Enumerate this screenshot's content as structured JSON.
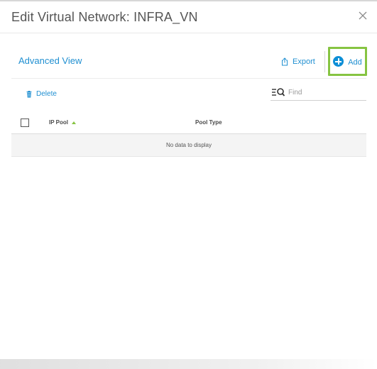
{
  "dialog": {
    "title": "Edit Virtual Network: INFRA_VN"
  },
  "panel": {
    "view_title": "Advanced View",
    "export_label": "Export",
    "add_label": "Add",
    "add_highlight_color": "#86c442",
    "accent_color": "#1f8fd1"
  },
  "toolbar": {
    "delete_label": "Delete",
    "find_placeholder": "Find",
    "find_value": ""
  },
  "table": {
    "columns": [
      {
        "label": "IP Pool",
        "sorted": "ascending"
      },
      {
        "label": "Pool Type"
      }
    ],
    "rows": [],
    "empty_message": "No data to display"
  },
  "icons": {
    "close": "close-icon",
    "export": "export-icon",
    "add": "plus-circle-icon",
    "delete": "trash-icon",
    "find": "filter-search-icon"
  }
}
